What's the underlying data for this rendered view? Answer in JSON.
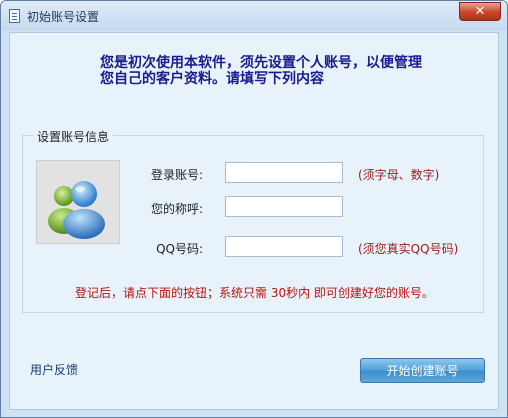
{
  "window": {
    "title": "初始账号设置",
    "close_label": "✕"
  },
  "intro": {
    "line1": "您是初次使用本软件，须先设置个人账号，以便管理",
    "line2": "您自己的客户资料。请填写下列内容"
  },
  "account_group": {
    "title": "设置账号信息",
    "avatar_icon": "users-icon",
    "fields": [
      {
        "label": "登录账号:",
        "value": "",
        "hint": "(须字母、数字)"
      },
      {
        "label": "您的称呼:",
        "value": "",
        "hint": ""
      },
      {
        "label": "QQ号码:",
        "value": "",
        "hint": "(须您真实QQ号码)"
      }
    ],
    "notice": "登记后，请点下面的按钮；系统只需 30秒内 即可创建好您的账号。"
  },
  "footer": {
    "feedback_label": "用户反馈",
    "create_button_label": "开始创建账号"
  },
  "colors": {
    "accent": "#4f9fd7",
    "notice": "#b4140f",
    "intro": "#1b1b8f"
  }
}
